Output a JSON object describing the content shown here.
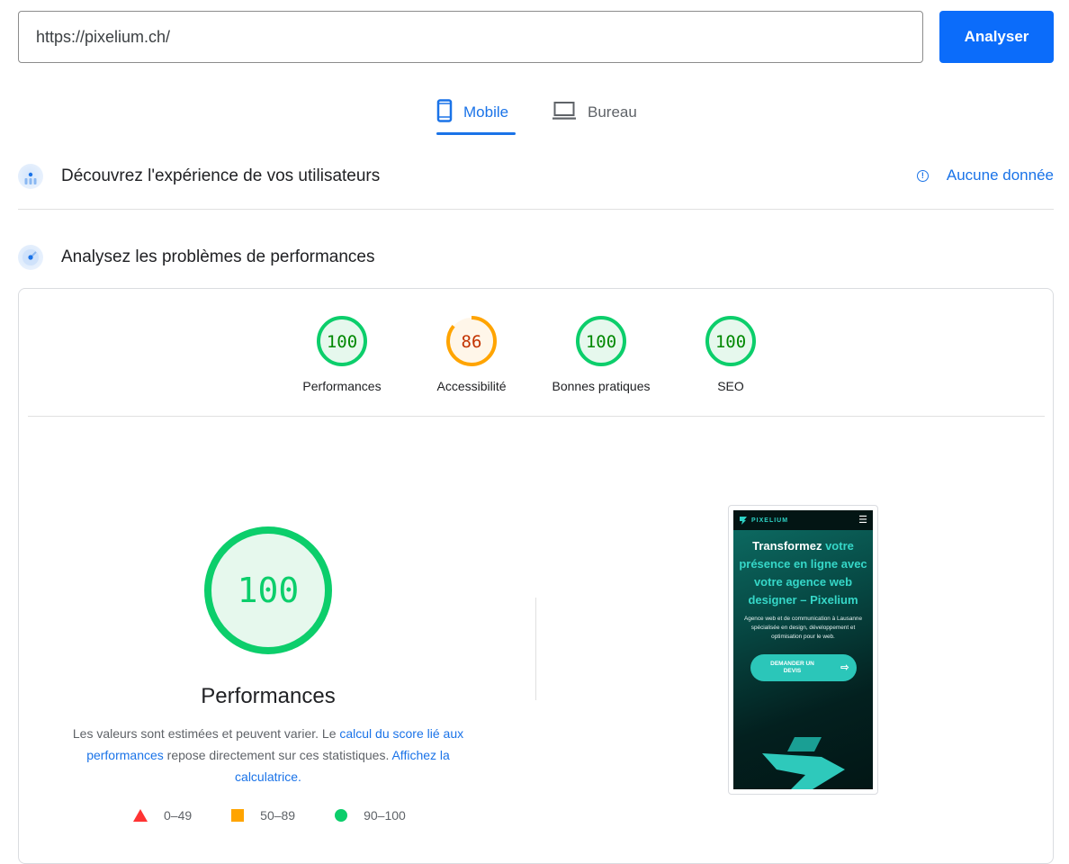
{
  "search": {
    "url_value": "https://pixelium.ch/",
    "analyse_label": "Analyser"
  },
  "tabs": [
    {
      "label": "Mobile",
      "icon": "smartphone-icon",
      "active": true
    },
    {
      "label": "Bureau",
      "icon": "laptop-icon",
      "active": false
    }
  ],
  "field_data": {
    "title": "Découvrez l'expérience de vos utilisateurs",
    "status_icon": "info-icon",
    "status_label": "Aucune donnée"
  },
  "lab_data": {
    "title": "Analysez les problèmes de performances"
  },
  "scores": [
    {
      "label": "Performances",
      "value": 100,
      "rating": "pass"
    },
    {
      "label": "Accessibilité",
      "value": 86,
      "rating": "average"
    },
    {
      "label": "Bonnes pratiques",
      "value": 100,
      "rating": "pass"
    },
    {
      "label": "SEO",
      "value": 100,
      "rating": "pass"
    }
  ],
  "colors": {
    "pass": "#0cce6b",
    "pass_text": "#008800",
    "pass_fill": "#e6f8ed",
    "average": "#ffa400",
    "average_text": "#c33300",
    "average_fill": "#fff6e9",
    "fail": "#ff3333",
    "link": "#1a73e8",
    "primary_button": "#0b6cfa"
  },
  "performance": {
    "score": 100,
    "title": "Performances",
    "desc_part1": "Les valeurs sont estimées et peuvent varier. Le ",
    "desc_link1": "calcul du score lié aux performances",
    "desc_part2": " repose directement sur ces statistiques. ",
    "desc_link2": "Affichez la calculatrice.",
    "legend": [
      {
        "shape": "triangle",
        "range": "0–49"
      },
      {
        "shape": "square",
        "range": "50–89"
      },
      {
        "shape": "circle",
        "range": "90–100"
      }
    ]
  },
  "screenshot": {
    "brand": "PIXELIUM",
    "hero_white": "Transformez",
    "hero_teal": " votre présence en ligne avec votre agence web designer – Pixelium",
    "subtitle": "Agence web et de communication à Lausanne spécialisée en design, développement et optimisation pour le web.",
    "cta": "DEMANDER UN DEVIS"
  }
}
